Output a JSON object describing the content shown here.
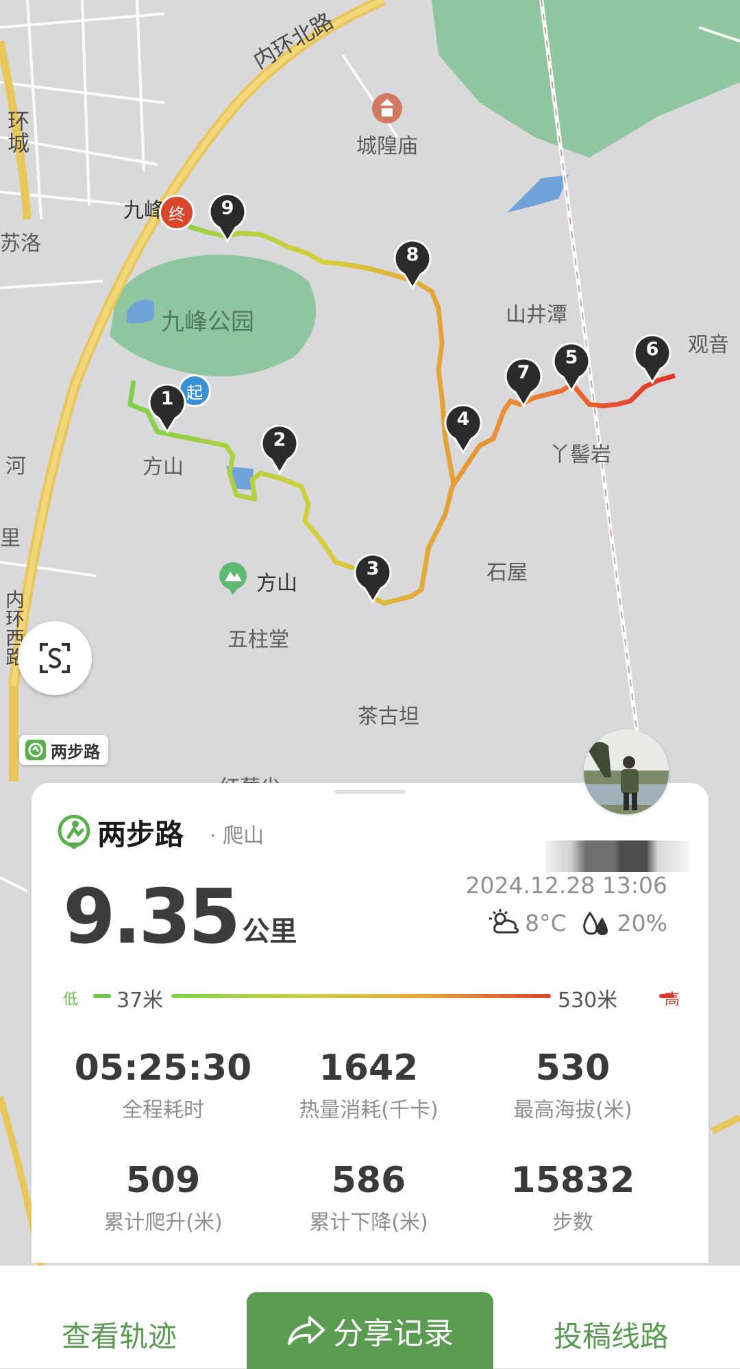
{
  "map": {
    "roads": [
      "内环北路",
      "环城",
      "苏洛",
      "河",
      "内环西路",
      "里"
    ],
    "places": [
      "城隍庙",
      "九峰公园",
      "山井潭",
      "观音",
      "方山",
      "丫髻岩",
      "石屋",
      "五柱堂",
      "茶古坦",
      "红莓尖"
    ],
    "scenic_place": "方山",
    "park_partial": "九峰",
    "start_marker": "起",
    "end_marker": "终",
    "waypoints": [
      "1",
      "2",
      "3",
      "4",
      "5",
      "6",
      "7",
      "8",
      "9"
    ],
    "watermark": "两步路"
  },
  "card": {
    "app_name": "两步路",
    "activity": "· 爬山",
    "datetime": "2024.12.28 13:06",
    "temperature": "8°C",
    "humidity": "20%",
    "distance_value": "9.35",
    "distance_unit": "公里",
    "elevation": {
      "low_label": "低",
      "min": "37米",
      "max": "530米",
      "high_label": "高"
    },
    "stats": [
      {
        "value": "05:25:30",
        "label": "全程耗时"
      },
      {
        "value": "1642",
        "label": "热量消耗(千卡)"
      },
      {
        "value": "530",
        "label": "最高海拔(米)"
      },
      {
        "value": "509",
        "label": "累计爬升(米)"
      },
      {
        "value": "586",
        "label": "累计下降(米)"
      },
      {
        "value": "15832",
        "label": "步数"
      }
    ]
  },
  "actions": {
    "view_track": "查看轨迹",
    "share": "分享记录",
    "submit_route": "投稿线路"
  }
}
